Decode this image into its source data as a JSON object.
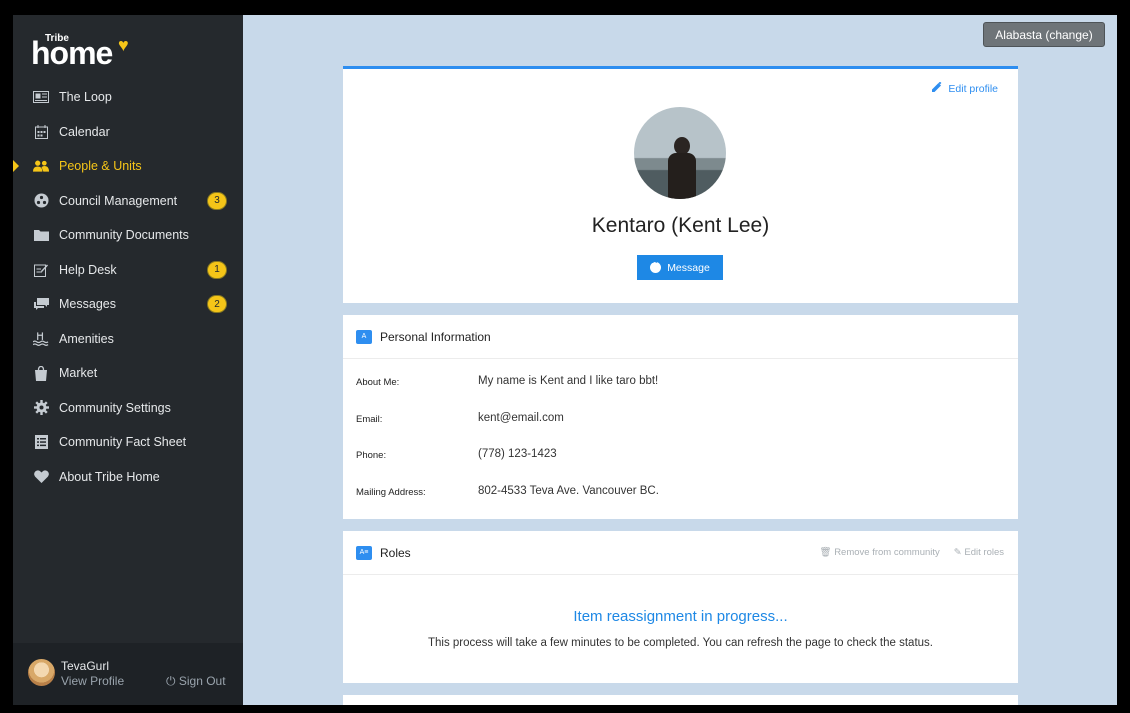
{
  "sidebar": {
    "logo_small": "Tribe",
    "logo_large": "home",
    "items": [
      {
        "label": "The Loop",
        "icon": "newspaper-icon"
      },
      {
        "label": "Calendar",
        "icon": "calendar-icon"
      },
      {
        "label": "People & Units",
        "icon": "people-icon",
        "active": true
      },
      {
        "label": "Council Management",
        "icon": "council-icon",
        "badge": "3"
      },
      {
        "label": "Community Documents",
        "icon": "folder-icon"
      },
      {
        "label": "Help Desk",
        "icon": "helpdesk-icon",
        "badge": "1"
      },
      {
        "label": "Messages",
        "icon": "messages-icon",
        "badge": "2"
      },
      {
        "label": "Amenities",
        "icon": "pool-icon"
      },
      {
        "label": "Market",
        "icon": "shopping-bag-icon"
      },
      {
        "label": "Community Settings",
        "icon": "gear-icon"
      },
      {
        "label": "Community Fact Sheet",
        "icon": "fact-sheet-icon"
      },
      {
        "label": "About Tribe Home",
        "icon": "heart-icon"
      }
    ],
    "user": {
      "name": "TevaGurl",
      "view_profile": "View Profile",
      "sign_out": "Sign Out"
    }
  },
  "header": {
    "community_button": "Alabasta (change)"
  },
  "profile": {
    "edit_label": "Edit profile",
    "name": "Kentaro (Kent Lee)",
    "message_label": "Message"
  },
  "personal_info": {
    "title": "Personal Information",
    "rows": [
      {
        "label": "About Me:",
        "value": "My name is Kent and I like taro bbt!"
      },
      {
        "label": "Email:",
        "value": "kent@email.com"
      },
      {
        "label": "Phone:",
        "value": "(778) 123-1423"
      },
      {
        "label": "Mailing Address:",
        "value": "802-4533 Teva Ave. Vancouver BC."
      }
    ]
  },
  "roles": {
    "title": "Roles",
    "remove_label": "Remove from community",
    "edit_label": "Edit roles",
    "status_title": "Item reassignment in progress...",
    "status_text": "This process will take a few minutes to be completed. You can refresh the page to check the status."
  },
  "colors": {
    "accent": "#1e88e5",
    "sidebar_bg": "#25292d",
    "active": "#f5c518",
    "main_bg": "#c8d9ea"
  }
}
